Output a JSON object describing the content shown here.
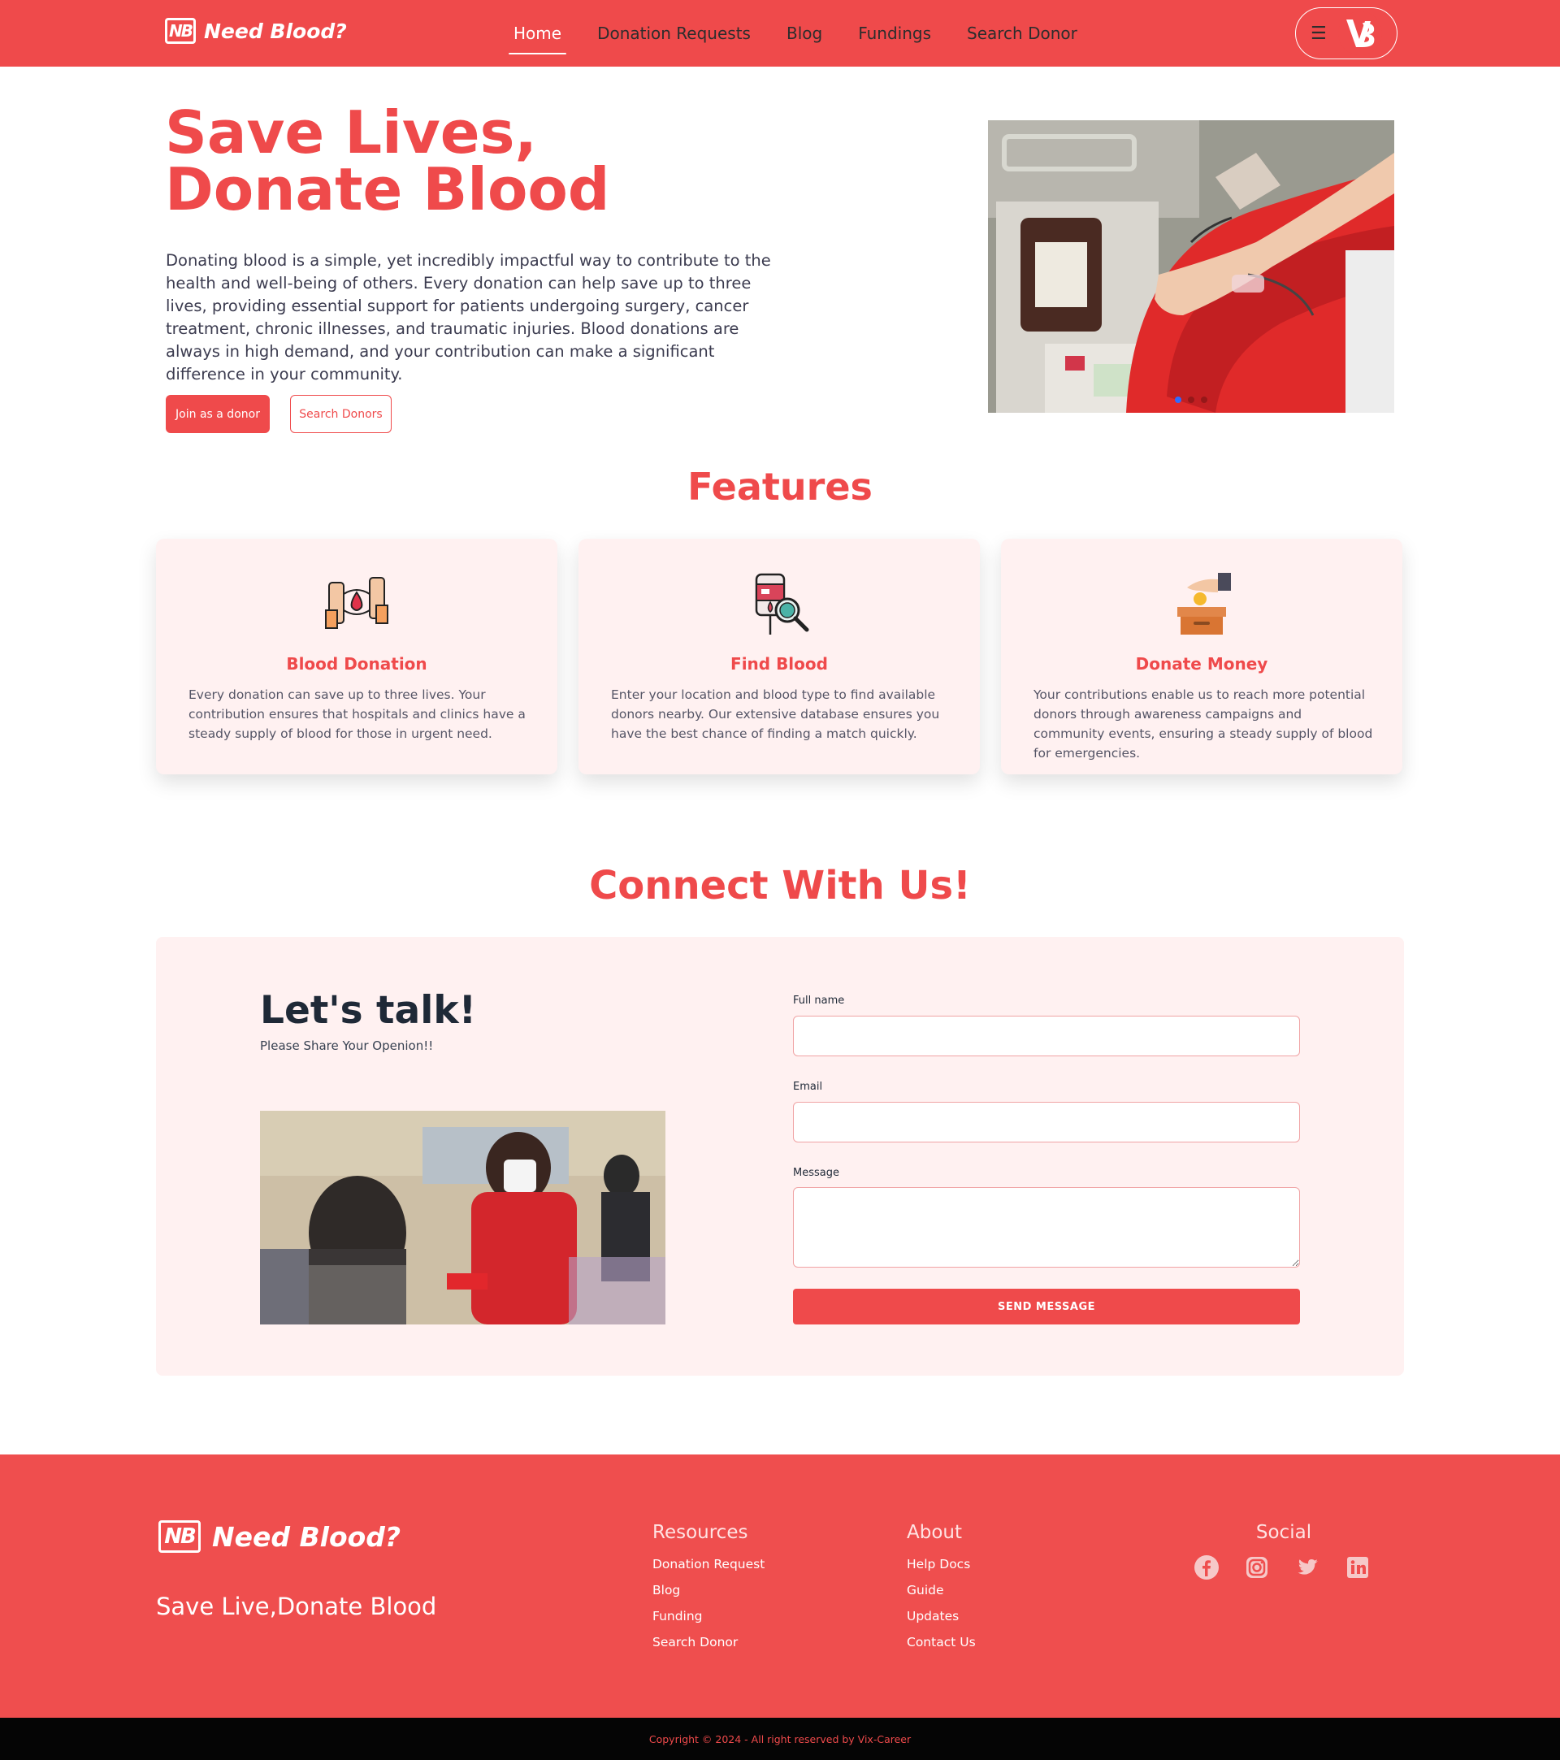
{
  "colors": {
    "primary": "#ef4a4b",
    "card_bg": "#fff1f1",
    "footer_bg": "#ef4e4e",
    "copyright_bg": "#050505"
  },
  "navbar": {
    "brand_logo": "NB",
    "brand_name": "Need Blood?",
    "links": [
      "Home",
      "Donation Requests",
      "Blog",
      "Fundings",
      "Search Donor"
    ],
    "active_link": "Home",
    "menu_icon": "hamburger-icon",
    "avatar_initial": "VB"
  },
  "hero": {
    "title": "Save Lives, Donate Blood",
    "description": "Donating blood is a simple, yet incredibly impactful way to contribute to the health and well-being of others. Every donation can help save up to three lives, providing essential support for patients undergoing surgery, cancer treatment, chronic illnesses, and traumatic injuries. Blood donations are always in high demand, and your contribution can make a significant difference in your community.",
    "primary_button": "Join as a donor",
    "secondary_button": "Search Donors",
    "carousel_active_slide": 1,
    "carousel_slide_count": 3
  },
  "features": {
    "title": "Features",
    "items": [
      {
        "icon": "blood-donation-icon",
        "title": "Blood Donation",
        "text": "Every donation can save up to three lives. Your contribution ensures that hospitals and clinics have a steady supply of blood for those in urgent need."
      },
      {
        "icon": "find-blood-icon",
        "title": "Find Blood",
        "text": "Enter your location and blood type to find available donors nearby. Our extensive database ensures you have the best chance of finding a match quickly."
      },
      {
        "icon": "donate-money-icon",
        "title": "Donate Money",
        "text": "Your contributions enable us to reach more potential donors through awareness campaigns and community events, ensuring a steady supply of blood for emergencies."
      }
    ]
  },
  "connect": {
    "title": "Connect With Us!",
    "heading": "Let's talk!",
    "subheading": "Please Share Your Openion!!",
    "form": {
      "name_label": "Full name",
      "name_value": "",
      "email_label": "Email",
      "email_value": "",
      "message_label": "Message",
      "message_value": "",
      "submit": "SEND MESSAGE"
    }
  },
  "footer": {
    "brand_logo": "NB",
    "brand_name": "Need Blood?",
    "tagline": "Save Live,Donate Blood",
    "resources_title": "Resources",
    "resources": [
      "Donation Request",
      "Blog",
      "Funding",
      "Search Donor"
    ],
    "about_title": "About",
    "about": [
      "Help Docs",
      "Guide",
      "Updates",
      "Contact Us"
    ],
    "social_title": "Social",
    "social_icons": [
      "facebook-icon",
      "instagram-icon",
      "twitter-icon",
      "linkedin-icon"
    ],
    "copyright": "Copyright © 2024 - All right reserved by Vix-Career"
  }
}
